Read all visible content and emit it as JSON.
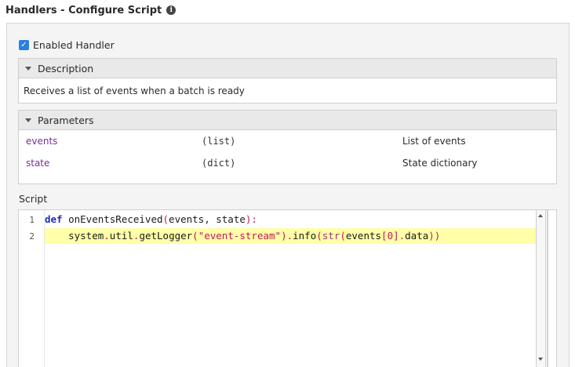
{
  "header": {
    "title": "Handlers - Configure Script",
    "info_icon": "info-circle-icon"
  },
  "enabled": {
    "label": "Enabled Handler",
    "checked": true
  },
  "description": {
    "title": "Description",
    "text": "Receives a list of events when a batch is ready"
  },
  "parameters": {
    "title": "Parameters",
    "rows": [
      {
        "name": "events",
        "type": "(list)",
        "desc": "List of events"
      },
      {
        "name": "state",
        "type": "(dict)",
        "desc": "State dictionary"
      }
    ]
  },
  "script": {
    "label": "Script",
    "line_numbers": [
      "1",
      "2"
    ],
    "line1": {
      "kw": "def",
      "fn": " onEventsReceived",
      "open": "(",
      "args": "events, state",
      "close": "):"
    },
    "line2": {
      "indent": "    ",
      "obj": "system",
      "d1": ".",
      "mod": "util",
      "d2": ".",
      "fn": "getLogger",
      "o1": "(",
      "str": "\"event-stream\"",
      "c1": ")",
      "d3": ".",
      "info": "info",
      "o2": "(",
      "bi": "str",
      "o3": "(",
      "ev": "events",
      "b1": "[",
      "num": "0",
      "b2": "]",
      "d4": ".",
      "data": "data",
      "c2": "))"
    }
  },
  "colors": {
    "accent": "#2d7fe0",
    "param_name": "#7a2f9e",
    "highlight": "#ffffa8"
  }
}
